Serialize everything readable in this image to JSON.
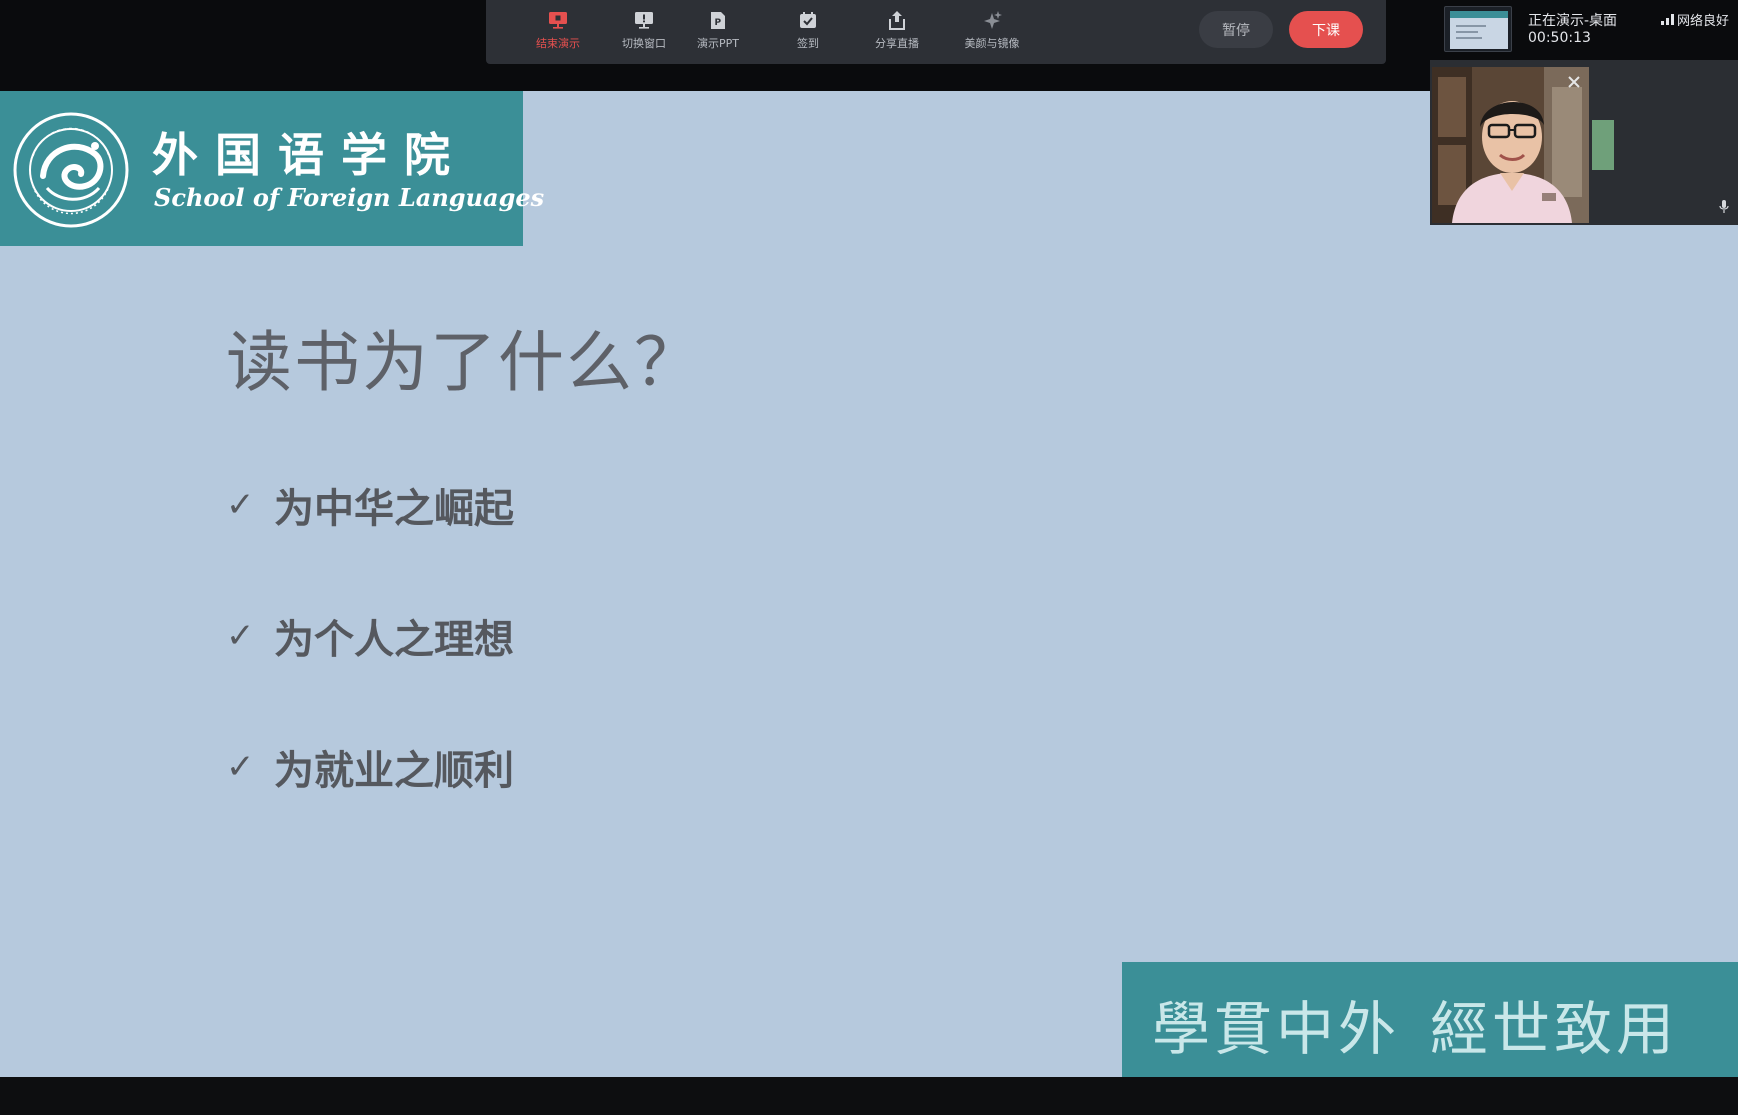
{
  "toolbar": {
    "tools": [
      {
        "label": "结束演示",
        "icon": "stop-present-icon",
        "active": true
      },
      {
        "label": "切换窗口",
        "icon": "switch-window-icon",
        "active": false
      },
      {
        "label": "演示PPT",
        "icon": "ppt-icon",
        "active": false
      },
      {
        "label": "签到",
        "icon": "check-in-icon",
        "active": false
      },
      {
        "label": "分享直播",
        "icon": "share-icon",
        "active": false
      },
      {
        "label": "美颜与镜像",
        "icon": "beauty-icon",
        "active": false
      }
    ],
    "pause_label": "暂停",
    "end_class_label": "下课"
  },
  "status": {
    "presenting_label": "正在演示-桌面",
    "elapsed_time": "00:50:13",
    "network_label": "网络良好"
  },
  "slide": {
    "school_name_cn": "外国语学院",
    "school_name_en": "School of Foreign Languages",
    "title": "读书为了什么？",
    "bullets": [
      {
        "check": "✓",
        "text": "为中华之崛起"
      },
      {
        "check": "✓",
        "text": "为个人之理想"
      },
      {
        "check": "✓",
        "text": "为就业之顺利"
      }
    ],
    "motto_part1": "學貫中外",
    "motto_part2": "經世致用"
  },
  "colors": {
    "accent_red": "#e5504f",
    "banner_teal": "#3b8f97",
    "slide_bg": "#b6c9dd",
    "toolbar_bg": "#2d3036"
  }
}
